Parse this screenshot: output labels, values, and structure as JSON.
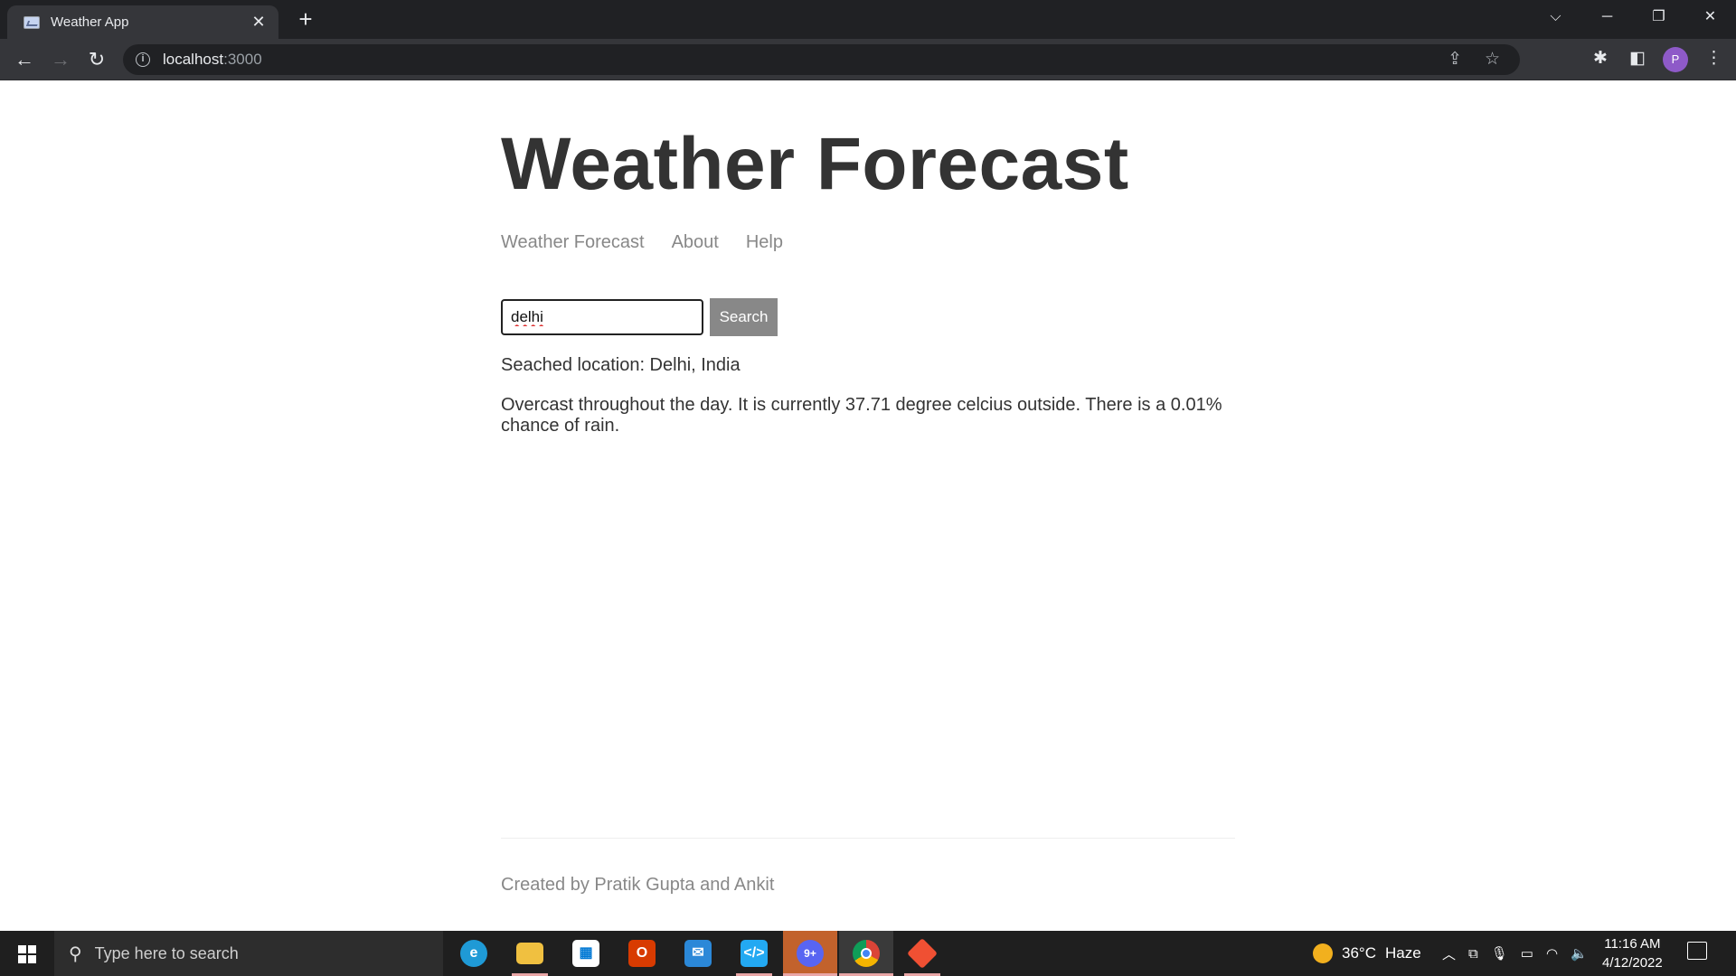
{
  "browser": {
    "tab_title": "Weather App",
    "tab_close": "✕",
    "new_tab": "+",
    "url_host": "localhost",
    "url_port": ":3000",
    "avatar_initial": "P",
    "window_controls": {
      "tabs_menu": "⌵",
      "minimize": "─",
      "restore": "❐",
      "close": "✕"
    }
  },
  "page": {
    "title": "Weather Forecast",
    "nav": [
      {
        "label": "Weather Forecast"
      },
      {
        "label": "About"
      },
      {
        "label": "Help"
      }
    ],
    "search": {
      "value": "delhi",
      "button_label": "Search"
    },
    "location_text": "Seached location: Delhi, India",
    "forecast_text": "Overcast throughout the day. It is currently 37.71 degree celcius outside. There is a 0.01% chance of rain.",
    "footer": "Created by Pratik Gupta and Ankit"
  },
  "taskbar": {
    "search_placeholder": "Type here to search",
    "weather": "36°C",
    "weather_desc": "Haze",
    "time": "11:16 AM",
    "date": "4/12/2022",
    "apps": [
      {
        "name": "edge-icon",
        "color": "#1f9ad6"
      },
      {
        "name": "file-explorer-icon",
        "color": "#f0c040"
      },
      {
        "name": "microsoft-store-icon",
        "color": "#ffffff"
      },
      {
        "name": "office-icon",
        "color": "#d83b01"
      },
      {
        "name": "mail-icon",
        "color": "#2b88d8"
      },
      {
        "name": "vscode-icon",
        "color": "#23a9f2"
      },
      {
        "name": "discord-icon",
        "color": "#e9773a",
        "badge": "9+"
      },
      {
        "name": "chrome-icon",
        "color": "#e0e0e0"
      },
      {
        "name": "git-icon",
        "color": "#f05033"
      }
    ]
  },
  "colors": {
    "title_text": "#333333",
    "nav_link": "#888888",
    "search_button": "#888888",
    "browser_dark": "#202124",
    "taskbar": "#1f1f1f"
  }
}
